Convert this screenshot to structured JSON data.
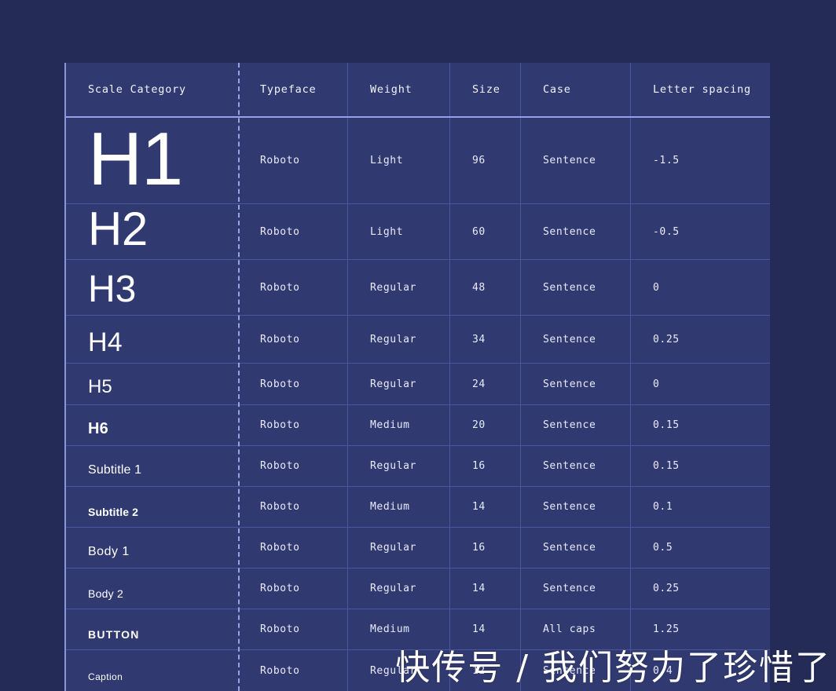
{
  "page": {
    "background_color": "#242b57",
    "table_background_color": "#313a70",
    "accent_border_color": "#95a0ea",
    "grid_line_color": "#4c56a0",
    "text_color": "#e9ebfa"
  },
  "table": {
    "columns": [
      {
        "key": "scale",
        "label": "Scale Category"
      },
      {
        "key": "type",
        "label": "Typeface"
      },
      {
        "key": "weight",
        "label": "Weight"
      },
      {
        "key": "size",
        "label": "Size"
      },
      {
        "key": "case",
        "label": "Case"
      },
      {
        "key": "ls",
        "label": "Letter spacing"
      }
    ],
    "rows": [
      {
        "scale": "H1",
        "typeface": "Roboto",
        "weight": "Light",
        "size": "96",
        "case": "Sentence",
        "letter_spacing": "-1.5"
      },
      {
        "scale": "H2",
        "typeface": "Roboto",
        "weight": "Light",
        "size": "60",
        "case": "Sentence",
        "letter_spacing": "-0.5"
      },
      {
        "scale": "H3",
        "typeface": "Roboto",
        "weight": "Regular",
        "size": "48",
        "case": "Sentence",
        "letter_spacing": "0"
      },
      {
        "scale": "H4",
        "typeface": "Roboto",
        "weight": "Regular",
        "size": "34",
        "case": "Sentence",
        "letter_spacing": "0.25"
      },
      {
        "scale": "H5",
        "typeface": "Roboto",
        "weight": "Regular",
        "size": "24",
        "case": "Sentence",
        "letter_spacing": "0"
      },
      {
        "scale": "H6",
        "typeface": "Roboto",
        "weight": "Medium",
        "size": "20",
        "case": "Sentence",
        "letter_spacing": "0.15"
      },
      {
        "scale": "Subtitle 1",
        "typeface": "Roboto",
        "weight": "Regular",
        "size": "16",
        "case": "Sentence",
        "letter_spacing": "0.15"
      },
      {
        "scale": "Subtitle 2",
        "typeface": "Roboto",
        "weight": "Medium",
        "size": "14",
        "case": "Sentence",
        "letter_spacing": "0.1"
      },
      {
        "scale": "Body 1",
        "typeface": "Roboto",
        "weight": "Regular",
        "size": "16",
        "case": "Sentence",
        "letter_spacing": "0.5"
      },
      {
        "scale": "Body 2",
        "typeface": "Roboto",
        "weight": "Regular",
        "size": "14",
        "case": "Sentence",
        "letter_spacing": "0.25"
      },
      {
        "scale": "BUTTON",
        "typeface": "Roboto",
        "weight": "Medium",
        "size": "14",
        "case": "All caps",
        "letter_spacing": "1.25"
      },
      {
        "scale": "Caption",
        "typeface": "Roboto",
        "weight": "Regular",
        "size": "12",
        "case": "Sentence",
        "letter_spacing": "0.4"
      }
    ]
  },
  "watermark": {
    "text": "快传号 / 我们努力了珍惜了"
  }
}
